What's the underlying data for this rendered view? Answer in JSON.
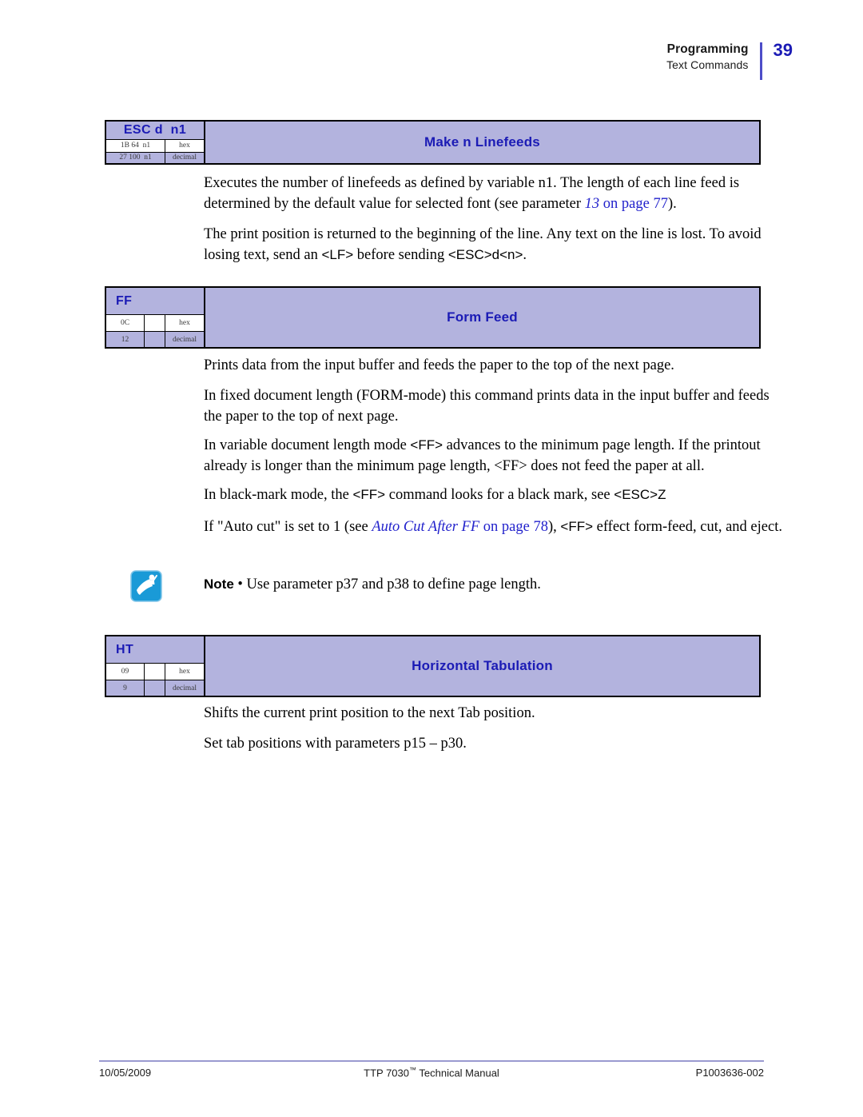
{
  "header": {
    "chapter": "Programming",
    "section": "Text Commands",
    "page_number": "39",
    "accent_color": "#1b1bb5"
  },
  "commands": [
    {
      "id": "esc-d-n1",
      "name": "ESC d  n1",
      "title": "Make n Linefeeds",
      "hex_bytes": "1B 64  n1",
      "hex_label": "hex",
      "decimal_bytes": "27 100  n1",
      "decimal_label": "decimal",
      "layout": "two-column"
    },
    {
      "id": "ff",
      "name": "FF",
      "title": "Form Feed",
      "hex_bytes": "0C",
      "hex_label": "hex",
      "decimal_bytes": "12",
      "decimal_label": "decimal",
      "layout": "three-column"
    },
    {
      "id": "ht",
      "name": "HT",
      "title": "Horizontal Tabulation",
      "hex_bytes": "09",
      "hex_label": "hex",
      "decimal_bytes": "9",
      "decimal_label": "decimal",
      "layout": "three-column"
    }
  ],
  "body": {
    "p1_a": "Executes the number of linefeeds as defined by variable n1. The length of each line feed is determined by the default value for selected font (see parameter ",
    "p1_link_italic": "13",
    "p1_link_rest": " on page 77",
    "p1_b": ").",
    "p2_a": "The print position is returned to the beginning of the line. Any text on the line is lost. To avoid losing text, send an ",
    "p2_tag1": "<LF>",
    "p2_b": " before sending ",
    "p2_tag2": "<ESC>d<n>",
    "p2_c": ".",
    "p3": "Prints data from the input buffer and feeds the paper to the top of the next page.",
    "p4": "In fixed document length (FORM-mode) this command prints data in the input buffer and feeds the paper to the top of next page.",
    "p5_a": "In variable document length mode ",
    "p5_tag1": "<FF>",
    "p5_b": " advances to the minimum page length. If the printout already is longer than the minimum page length, <FF> does not feed the paper at all.",
    "p6_a": "In black-mark mode, the ",
    "p6_tag1": "<FF>",
    "p6_b": " command looks for a black mark, see ",
    "p6_tag2": "<ESC>Z",
    "p7_a": "If \"Auto cut\" is set to 1 (see ",
    "p7_link_italic": "Auto Cut After FF",
    "p7_link_rest": " on page 78",
    "p7_b": "), ",
    "p7_tag1": "<FF>",
    "p7_c": " effect form-feed, cut, and eject.",
    "p8": "Shifts the current print position to the next Tab position.",
    "p9": "Set tab positions with parameters p15 – p30."
  },
  "note": {
    "label": "Note",
    "bullet": "•",
    "text": "Use parameter p37 and p38 to define page length.",
    "icon_color": "#1a9ad7"
  },
  "footer": {
    "date": "10/05/2009",
    "manual_prefix": "TTP 7030",
    "manual_tm": "™",
    "manual_suffix": " Technical Manual",
    "part_number": "P1003636-002",
    "rule_color": "#9a9ad0"
  }
}
